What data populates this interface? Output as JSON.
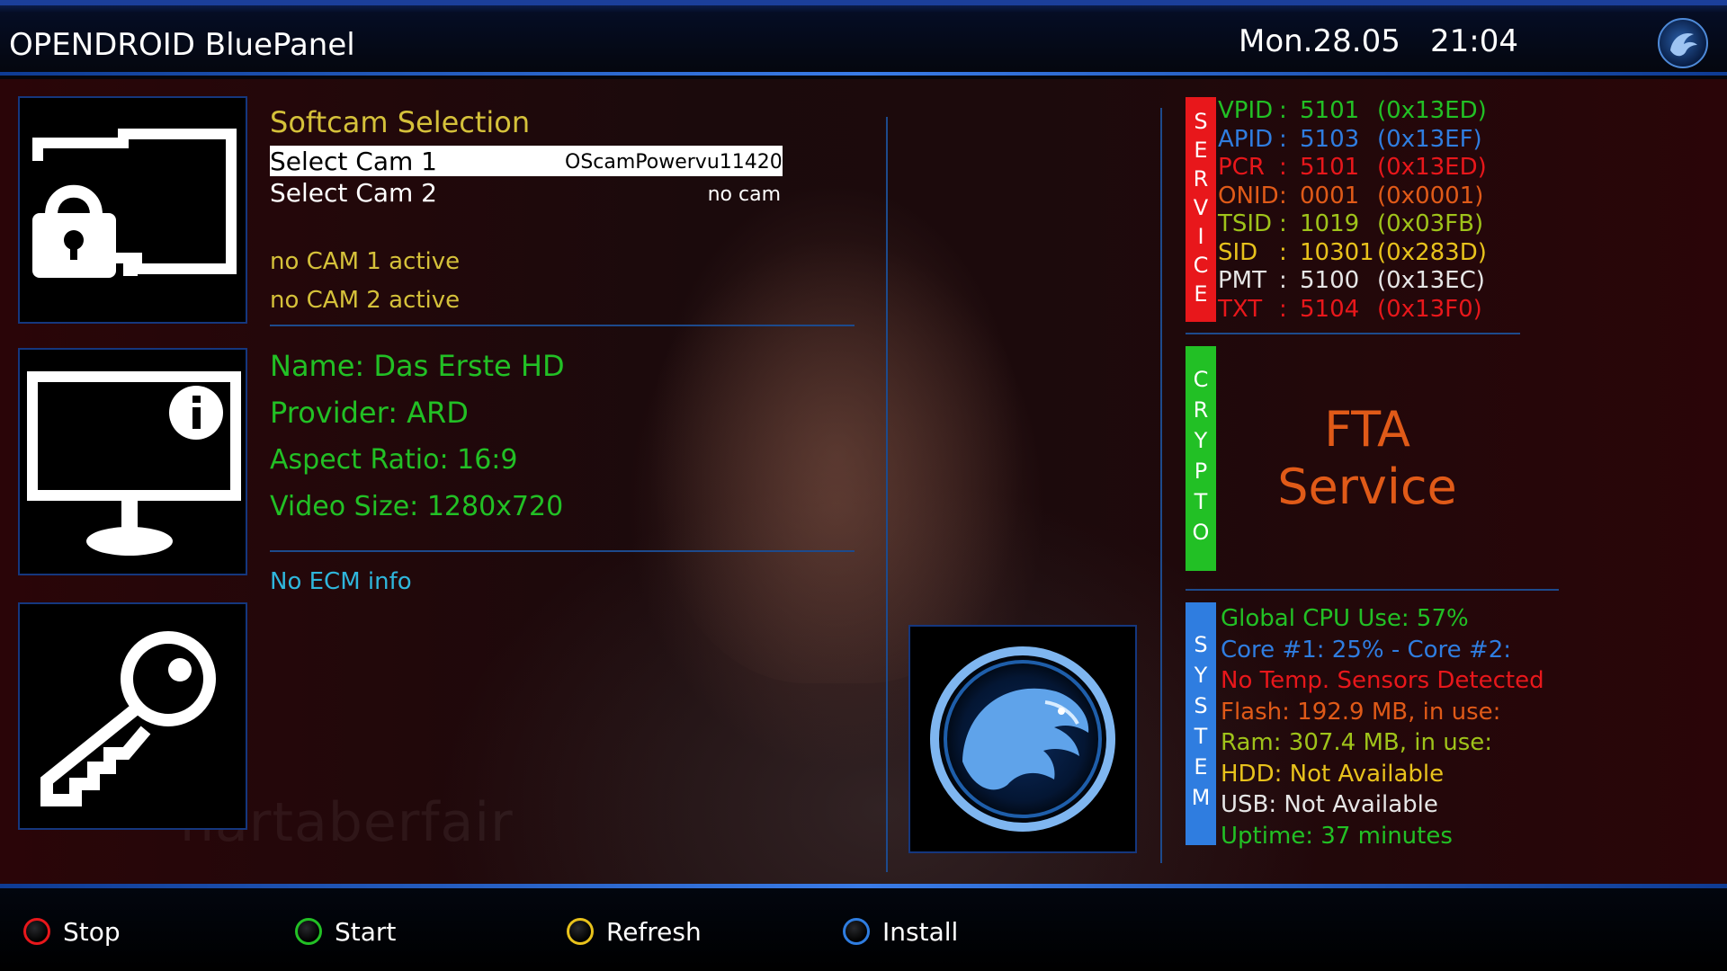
{
  "header": {
    "title": "OPENDROID BluePanel",
    "date": "Mon.28.05",
    "time": "21:04",
    "logo_icon": "opendroid-eagle-icon"
  },
  "left_icons": [
    {
      "name": "lock-screen-icon"
    },
    {
      "name": "monitor-info-icon"
    },
    {
      "name": "key-icon"
    }
  ],
  "softcam": {
    "heading": "Softcam Selection",
    "cams": [
      {
        "label": "Select Cam 1",
        "value": "OScamPowervu11420"
      },
      {
        "label": "Select Cam 2",
        "value": "no cam"
      }
    ],
    "status": [
      "no CAM 1 active",
      "no CAM 2 active"
    ]
  },
  "channel": {
    "name": "Name: Das Erste HD",
    "provider": "Provider: ARD",
    "aspect": "Aspect Ratio: 16:9",
    "video_size": "Video Size: 1280x720"
  },
  "ecm": "No ECM info",
  "service": {
    "tag": "SERVICE",
    "rows": [
      {
        "key": "VPID",
        "sep": ":",
        "val": "5101",
        "hex": "(0x13ED)",
        "color": "#22c025"
      },
      {
        "key": "APID",
        "sep": ":",
        "val": "5103",
        "hex": "(0x13EF)",
        "color": "#2f7de0"
      },
      {
        "key": "PCR",
        "sep": ":",
        "val": "5101",
        "hex": "(0x13ED)",
        "color": "#e8171b"
      },
      {
        "key": "ONID",
        "sep": ":",
        "val": "0001",
        "hex": "(0x0001)",
        "color": "#e05a18"
      },
      {
        "key": "TSID",
        "sep": ":",
        "val": "1019",
        "hex": "(0x03FB)",
        "color": "#9fc31a"
      },
      {
        "key": "SID",
        "sep": ":",
        "val": "10301",
        "hex": "(0x283D)",
        "color": "#e8c21c"
      },
      {
        "key": "PMT",
        "sep": ":",
        "val": "5100",
        "hex": "(0x13EC)",
        "color": "#e6e6e6"
      },
      {
        "key": "TXT",
        "sep": ":",
        "val": "5104",
        "hex": "(0x13F0)",
        "color": "#e8171b"
      }
    ]
  },
  "crypto": {
    "tag": "CRYPTO",
    "line1": "FTA",
    "line2": "Service"
  },
  "system": {
    "tag": "SYSTEM",
    "rows": [
      {
        "text": "Global CPU Use:  57%",
        "color": "#22c025"
      },
      {
        "text": "Core #1:  25%  -  Core #2:",
        "color": "#2f7de0"
      },
      {
        "text": "No Temp. Sensors Detected",
        "color": "#e8171b"
      },
      {
        "text": "Flash: 192.9 MB, in use:",
        "color": "#e05a18"
      },
      {
        "text": "Ram: 307.4 MB, in use:",
        "color": "#9fc31a"
      },
      {
        "text": "HDD: Not Available",
        "color": "#e8c21c"
      },
      {
        "text": "USB: Not Available",
        "color": "#e6e6e6"
      },
      {
        "text": "Uptime: 37 minutes",
        "color": "#22c025"
      }
    ]
  },
  "buttons": [
    {
      "label": "Stop",
      "color": "#e8171b"
    },
    {
      "label": "Start",
      "color": "#22c025"
    },
    {
      "label": "Refresh",
      "color": "#e8c21c"
    },
    {
      "label": "Install",
      "color": "#2f7de0"
    }
  ],
  "background_watermark": "hartaberfair"
}
